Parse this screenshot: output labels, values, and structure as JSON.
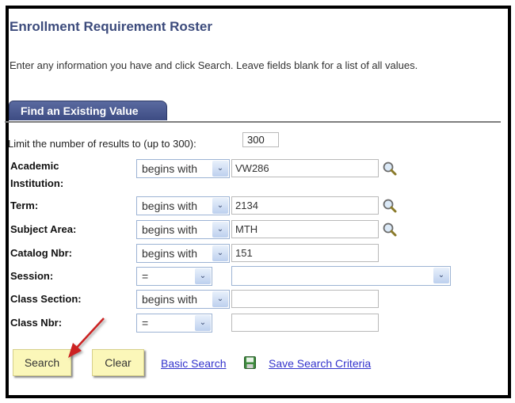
{
  "page": {
    "title": "Enrollment Requirement Roster",
    "instructions": "Enter any information you have and click Search. Leave fields blank for a list of all values."
  },
  "tabs": [
    {
      "label": "Find an Existing Value",
      "active": true
    }
  ],
  "limit": {
    "label": "Limit the number of results to (up to 300):",
    "value": "300"
  },
  "fields": [
    {
      "label_line1": "Academic",
      "label_line2": "Institution:",
      "operator": "begins with",
      "value": "VW286",
      "lookup": true
    },
    {
      "label": "Term:",
      "operator": "begins with",
      "value": "2134",
      "lookup": true
    },
    {
      "label": "Subject Area:",
      "operator": "begins with",
      "value": "MTH",
      "lookup": true
    },
    {
      "label": "Catalog Nbr:",
      "operator": "begins with",
      "value": "151",
      "lookup": false
    },
    {
      "label": "Session:",
      "operator": "=",
      "value": "",
      "lookup": false,
      "value_is_select": true
    },
    {
      "label": "Class Section:",
      "operator": "begins with",
      "value": "",
      "lookup": false
    },
    {
      "label": "Class Nbr:",
      "operator": "=",
      "value": "",
      "lookup": false
    }
  ],
  "actions": {
    "search_label": "Search",
    "clear_label": "Clear",
    "basic_search_label": "Basic Search",
    "save_criteria_label": "Save Search Criteria"
  },
  "icons": {
    "lookup": "magnifier-icon",
    "dropdown": "chevron-down-icon",
    "save": "floppy-disk-icon",
    "annotation": "red-arrow-pointer"
  },
  "colors": {
    "title": "#3c4b7c",
    "tab_bg": "#4a5a92",
    "button_bg": "#fbf7b9",
    "link": "#3333cc",
    "arrow": "#cc2222"
  }
}
